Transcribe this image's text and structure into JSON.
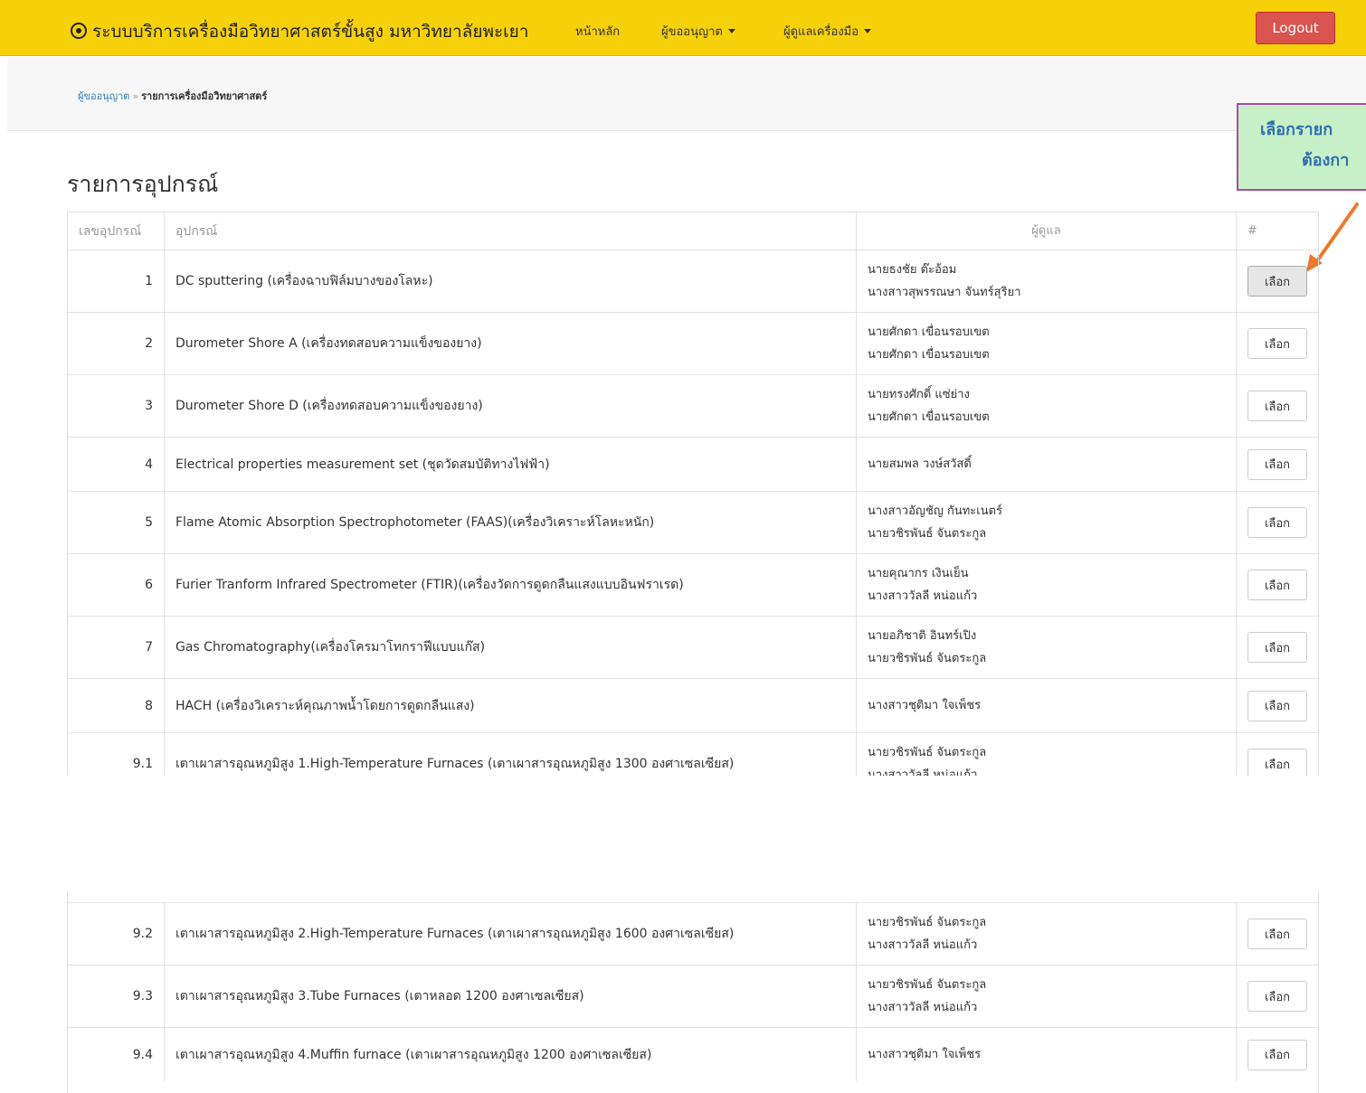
{
  "nav": {
    "brand": "ระบบบริการเครื่องมือวิทยาศาสตร์ขั้นสูง มหาวิทยาลัยพะเยา",
    "home": "หน้าหลัก",
    "requester": "ผู้ขออนุญาต",
    "manager": "ผู้ดูแลเครื่องมือ",
    "logout": "Logout"
  },
  "breadcrumb": {
    "parent": "ผู้ขออนุญาต",
    "separator": "»",
    "current": "รายการเครื่องมือวิทยาศาสตร์"
  },
  "page_title": "รายการอุปกรณ์",
  "callout": {
    "line1": "เลือกรายก",
    "line2": "ต้องกา",
    "arrow_color": "#ec7a2b"
  },
  "table": {
    "headers": [
      "เลขอุปกรณ์",
      "อุปกรณ์",
      "ผู้ดูแล",
      "#"
    ],
    "button_label": "เลือก",
    "rows": [
      {
        "no": "1",
        "name": "DC sputtering (เครื่องฉาบฟิล์มบางของโลหะ)",
        "staff": [
          "นายธงชัย ต๊ะอ้อม",
          "นางสาวสุพรรณษา จันทร์สุริยา"
        ]
      },
      {
        "no": "2",
        "name": "Durometer Shore A (เครื่องทดสอบความแข็งของยาง)",
        "staff": [
          "นายศักดา เขื่อนรอบเขต",
          "นายศักดา เขื่อนรอบเขต"
        ]
      },
      {
        "no": "3",
        "name": "Durometer Shore D (เครื่องทดสอบความแข็งของยาง)",
        "staff": [
          "นายทรงศักดิ์ แซ่ย่าง",
          "นายศักดา เขื่อนรอบเขต"
        ]
      },
      {
        "no": "4",
        "name": "Electrical properties measurement set (ชุดวัดสมบัติทางไฟฟ้า)",
        "staff": [
          "นายสมพล วงษ์สวัสดิ์"
        ]
      },
      {
        "no": "5",
        "name": "Flame Atomic Absorption Spectrophotometer (FAAS)(เครื่องวิเคราะห์โลหะหนัก)",
        "staff": [
          "นางสาวอัญชัญ กันทะเนตร์",
          "นายวชิรพันธ์ จันตระกูล"
        ]
      },
      {
        "no": "6",
        "name": "Furier Tranform Infrared Spectrometer (FTIR)(เครื่องวัดการดูดกลืนแสงแบบอินฟราเรด)",
        "staff": [
          "นายคุณากร เงินเย็น",
          "นางสาววัลลี หน่อแก้ว"
        ]
      },
      {
        "no": "7",
        "name": "Gas Chromatography(เครื่องโครมาโทกราฟีแบบแก๊ส)",
        "staff": [
          "นายอภิชาติ อินทร์เปิง",
          "นายวชิรพันธ์ จันตระกูล"
        ]
      },
      {
        "no": "8",
        "name": "HACH (เครื่องวิเคราะห์คุณภาพน้ำโดยการดูดกลืนแสง)",
        "staff": [
          "นางสาวชุติมา ใจเพ็ชร"
        ]
      },
      {
        "no": "9.1",
        "name": "เตาเผาสารอุณหภูมิสูง 1.High-Temperature Furnaces (เตาเผาสารอุณหภูมิสูง 1300 องศาเซลเซียส)",
        "staff": [
          "นายวชิรพันธ์ จันตระกูล",
          "นางสาววัลลี หน่อแก้ว"
        ]
      }
    ],
    "rows_continued": [
      {
        "no": "9.2",
        "name": "เตาเผาสารอุณหภูมิสูง 2.High-Temperature Furnaces (เตาเผาสารอุณหภูมิสูง 1600 องศาเซลเซียส)",
        "staff": [
          "นายวชิรพันธ์ จันตระกูล",
          "นางสาววัลลี หน่อแก้ว"
        ]
      },
      {
        "no": "9.3",
        "name": "เตาเผาสารอุณหภูมิสูง 3.Tube Furnaces (เตาหลอด 1200 องศาเซลเซียส)",
        "staff": [
          "นายวชิรพันธ์ จันตระกูล",
          "นางสาววัลลี หน่อแก้ว"
        ]
      },
      {
        "no": "9.4",
        "name": "เตาเผาสารอุณหภูมิสูง 4.Muffin furnace (เตาเผาสารอุณหภูมิสูง 1200 องศาเซลเซียส)",
        "staff": [
          "นางสาวชุติมา ใจเพ็ชร"
        ]
      }
    ]
  }
}
